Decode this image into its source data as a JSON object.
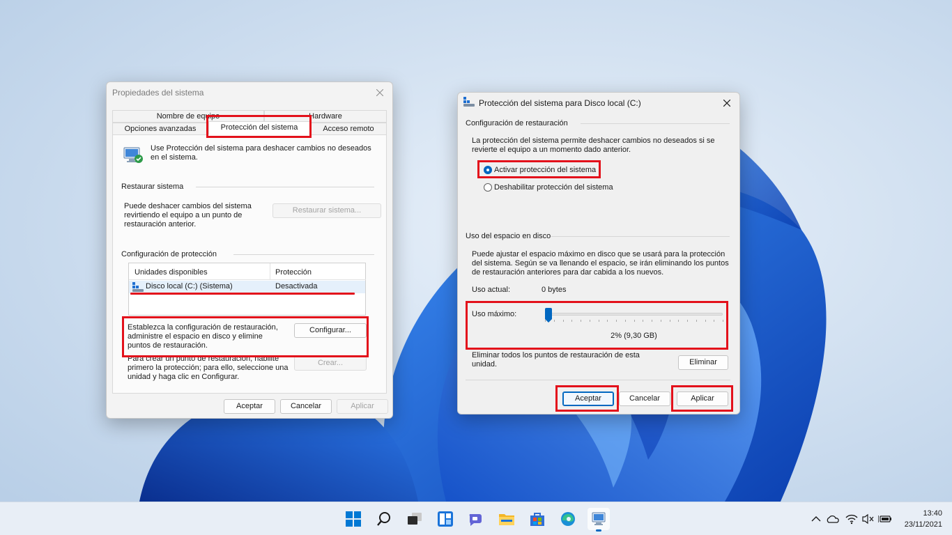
{
  "left_dialog": {
    "title": "Propiedades del sistema",
    "tabs_row1": [
      "Nombre de equipo",
      "Hardware"
    ],
    "tabs_row2": [
      "Opciones avanzadas",
      "Protección del sistema",
      "Acceso remoto"
    ],
    "intro": "Use Protección del sistema para deshacer cambios no deseados en el sistema.",
    "restore_group": "Restaurar sistema",
    "restore_text": "Puede deshacer cambios del sistema revirtiendo el equipo a un punto de restauración anterior.",
    "restore_button": "Restaurar sistema...",
    "protection_group": "Configuración de protección",
    "columns": [
      "Unidades disponibles",
      "Protección"
    ],
    "drives": [
      {
        "name": "Disco local (C:) (Sistema)",
        "status": "Desactivada"
      }
    ],
    "configure_text": "Establezca la configuración de restauración, administre el espacio en disco y elimine puntos de restauración.",
    "configure_button": "Configurar...",
    "create_text": "Para crear un punto de restauración, habilite primero la protección; para ello, seleccione una unidad y haga clic en Configurar.",
    "create_button": "Crear...",
    "ok": "Aceptar",
    "cancel": "Cancelar",
    "apply": "Aplicar"
  },
  "right_dialog": {
    "title": "Protección del sistema para Disco local (C:)",
    "restore_group": "Configuración de restauración",
    "restore_text": "La protección del sistema permite deshacer cambios no deseados si se revierte el equipo a un momento dado anterior.",
    "radio_on": "Activar protección del sistema",
    "radio_off": "Deshabilitar protección del sistema",
    "disk_group": "Uso del espacio en disco",
    "disk_text": "Puede ajustar el espacio máximo en disco que se usará para la protección del sistema. Según se va llenando el espacio, se irán eliminando los puntos de restauración anteriores para dar cabida a los nuevos.",
    "current_label": "Uso actual:",
    "current_value": "0 bytes",
    "max_label": "Uso máximo:",
    "slider_percent": 2,
    "slider_value": "2% (9,30 GB)",
    "delete_text": "Eliminar todos los puntos de restauración de esta unidad.",
    "delete_button": "Eliminar",
    "ok": "Aceptar",
    "cancel": "Cancelar",
    "apply": "Aplicar"
  },
  "taskbar": {
    "icons": [
      "start-icon",
      "search-icon",
      "task-view-icon",
      "widgets-icon",
      "chat-icon",
      "file-explorer-icon",
      "store-icon",
      "edge-icon",
      "system-properties-icon"
    ],
    "time": "13:40",
    "date": "23/11/2021"
  },
  "colors": {
    "accent": "#0067c0",
    "highlight_red": "#e3111b",
    "wallpaper_blue": "#1a5fd9"
  }
}
